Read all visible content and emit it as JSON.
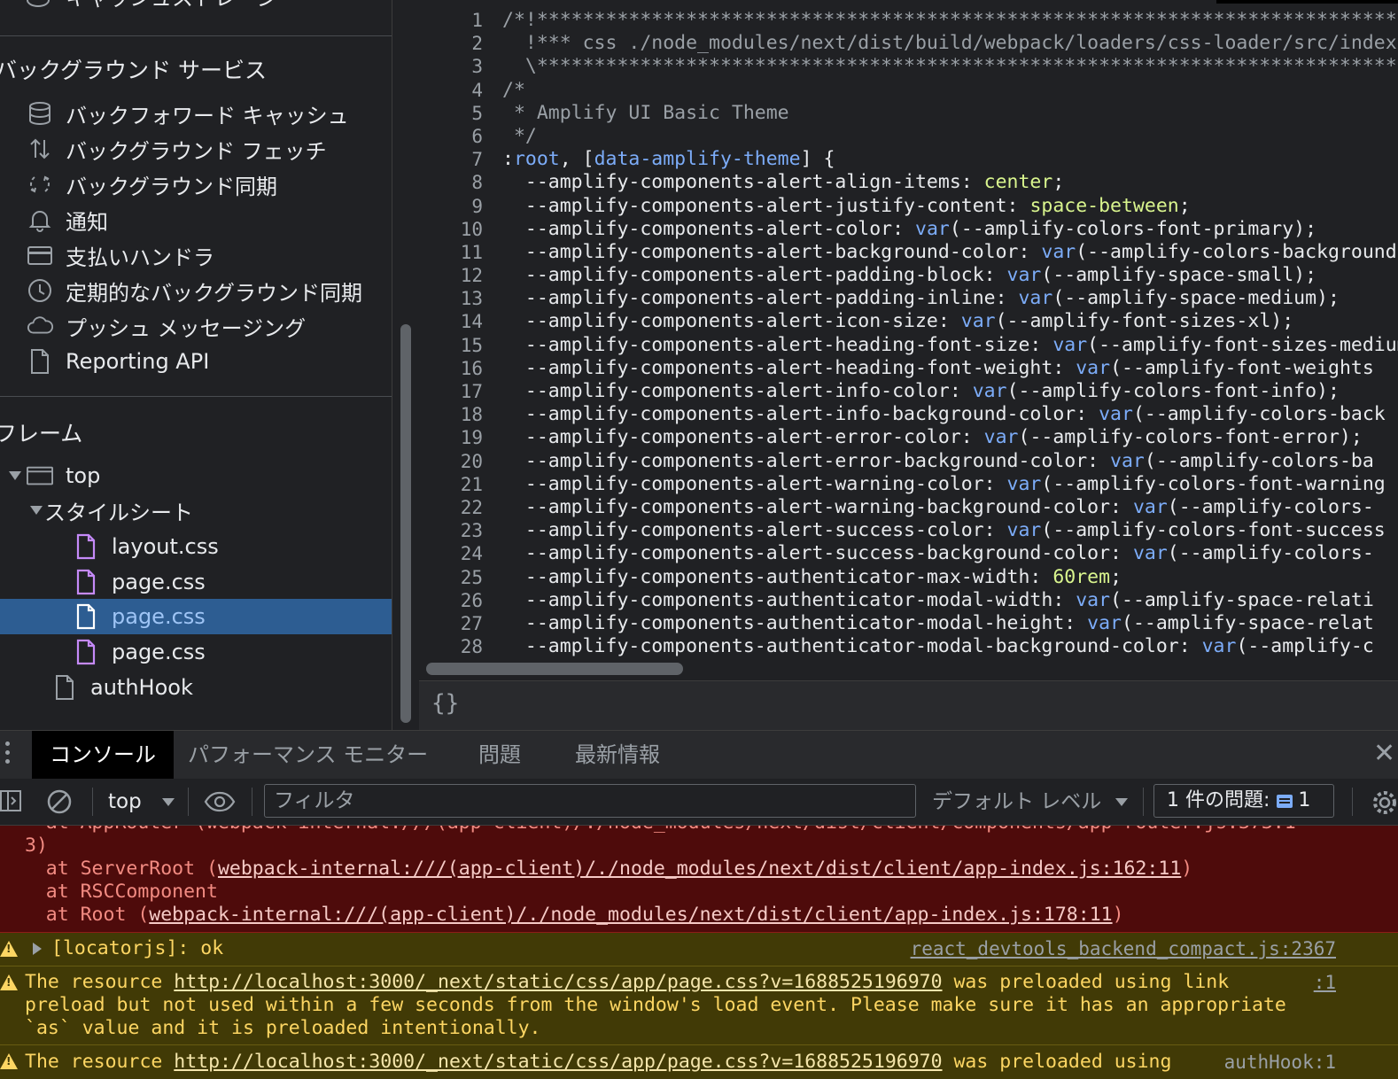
{
  "left_panel": {
    "top_partial_label": "キャッシュストレージ",
    "background_services": {
      "title": "バックグラウンド サービス",
      "items": [
        {
          "label": "バックフォワード キャッシュ",
          "icon": "database-icon"
        },
        {
          "label": "バックグラウンド フェッチ",
          "icon": "up-down-arrows-icon"
        },
        {
          "label": "バックグラウンド同期",
          "icon": "sync-icon"
        },
        {
          "label": "通知",
          "icon": "bell-icon"
        },
        {
          "label": "支払いハンドラ",
          "icon": "credit-card-icon"
        },
        {
          "label": "定期的なバックグラウンド同期",
          "icon": "clock-icon"
        },
        {
          "label": "プッシュ メッセージング",
          "icon": "cloud-icon"
        },
        {
          "label": "Reporting API",
          "icon": "document-icon"
        }
      ]
    },
    "frames": {
      "title": "フレーム",
      "top": "top",
      "stylesheets": "スタイルシート",
      "files": [
        "layout.css",
        "page.css",
        "page.css",
        "page.css"
      ],
      "selected_index": 2,
      "script": "authHook"
    }
  },
  "editor": {
    "lines": [
      "/*!*************************************************************************************",
      "  !*** css ./node_modules/next/dist/build/webpack/loaders/css-loader/src/index.js",
      "  \\*************************************************************************************",
      "/*",
      " * Amplify UI Basic Theme",
      " */",
      ":root, [data-amplify-theme] {",
      "  --amplify-components-alert-align-items: center;",
      "  --amplify-components-alert-justify-content: space-between;",
      "  --amplify-components-alert-color: var(--amplify-colors-font-primary);",
      "  --amplify-components-alert-background-color: var(--amplify-colors-background",
      "  --amplify-components-alert-padding-block: var(--amplify-space-small);",
      "  --amplify-components-alert-padding-inline: var(--amplify-space-medium);",
      "  --amplify-components-alert-icon-size: var(--amplify-font-sizes-xl);",
      "  --amplify-components-alert-heading-font-size: var(--amplify-font-sizes-medium",
      "  --amplify-components-alert-heading-font-weight: var(--amplify-font-weights",
      "  --amplify-components-alert-info-color: var(--amplify-colors-font-info);",
      "  --amplify-components-alert-info-background-color: var(--amplify-colors-back",
      "  --amplify-components-alert-error-color: var(--amplify-colors-font-error);",
      "  --amplify-components-alert-error-background-color: var(--amplify-colors-ba",
      "  --amplify-components-alert-warning-color: var(--amplify-colors-font-warning",
      "  --amplify-components-alert-warning-background-color: var(--amplify-colors-",
      "  --amplify-components-alert-success-color: var(--amplify-colors-font-success",
      "  --amplify-components-alert-success-background-color: var(--amplify-colors-",
      "  --amplify-components-authenticator-max-width: 60rem;",
      "  --amplify-components-authenticator-modal-width: var(--amplify-space-relati",
      "  --amplify-components-authenticator-modal-height: var(--amplify-space-relat",
      "  --amplify-components-authenticator-modal-background-color: var(--amplify-c"
    ],
    "format_icon": "{}"
  },
  "drawer": {
    "tabs": [
      "コンソール",
      "パフォーマンス モニター",
      "問題",
      "最新情報"
    ],
    "active_tab": 0
  },
  "toolbar": {
    "context": "top",
    "filter_placeholder": "フィルタ",
    "levels": "デフォルト レベル",
    "issues_label": "1 件の問題:",
    "issues_count": "1"
  },
  "console": {
    "error": {
      "line0": "    at AppRouter (webpack-internal:///(app-client)/./node_modules/next/dist/client/components/app-router.js:373:1",
      "line1": "3)",
      "line2_prefix": "    at ServerRoot (",
      "line2_link": "webpack-internal:///(app-client)/./node_modules/next/dist/client/app-index.js:162:11",
      "line2_suffix": ")",
      "line3": "    at RSCComponent",
      "line4_prefix": "    at Root (",
      "line4_link": "webpack-internal:///(app-client)/./node_modules/next/dist/client/app-index.js:178:11",
      "line4_suffix": ")"
    },
    "warn1": {
      "text": "[locatorjs]: ok",
      "source": "react_devtools_backend_compact.js:2367"
    },
    "warn2": {
      "prefix": "The resource ",
      "link": "http://localhost:3000/_next/static/css/app/page.css?v=1688525196970",
      "suffix": " was preloaded using link",
      "line2": "preload but not used within a few seconds from the window's load event. Please make sure it has an appropriate",
      "line3": "`as` value and it is preloaded intentionally.",
      "source": ":1"
    },
    "warn3": {
      "prefix": "The resource ",
      "link": "http://localhost:3000/_next/static/css/app/page.css?v=1688525196970",
      "suffix": " was preloaded using",
      "source": "authHook:1"
    }
  }
}
